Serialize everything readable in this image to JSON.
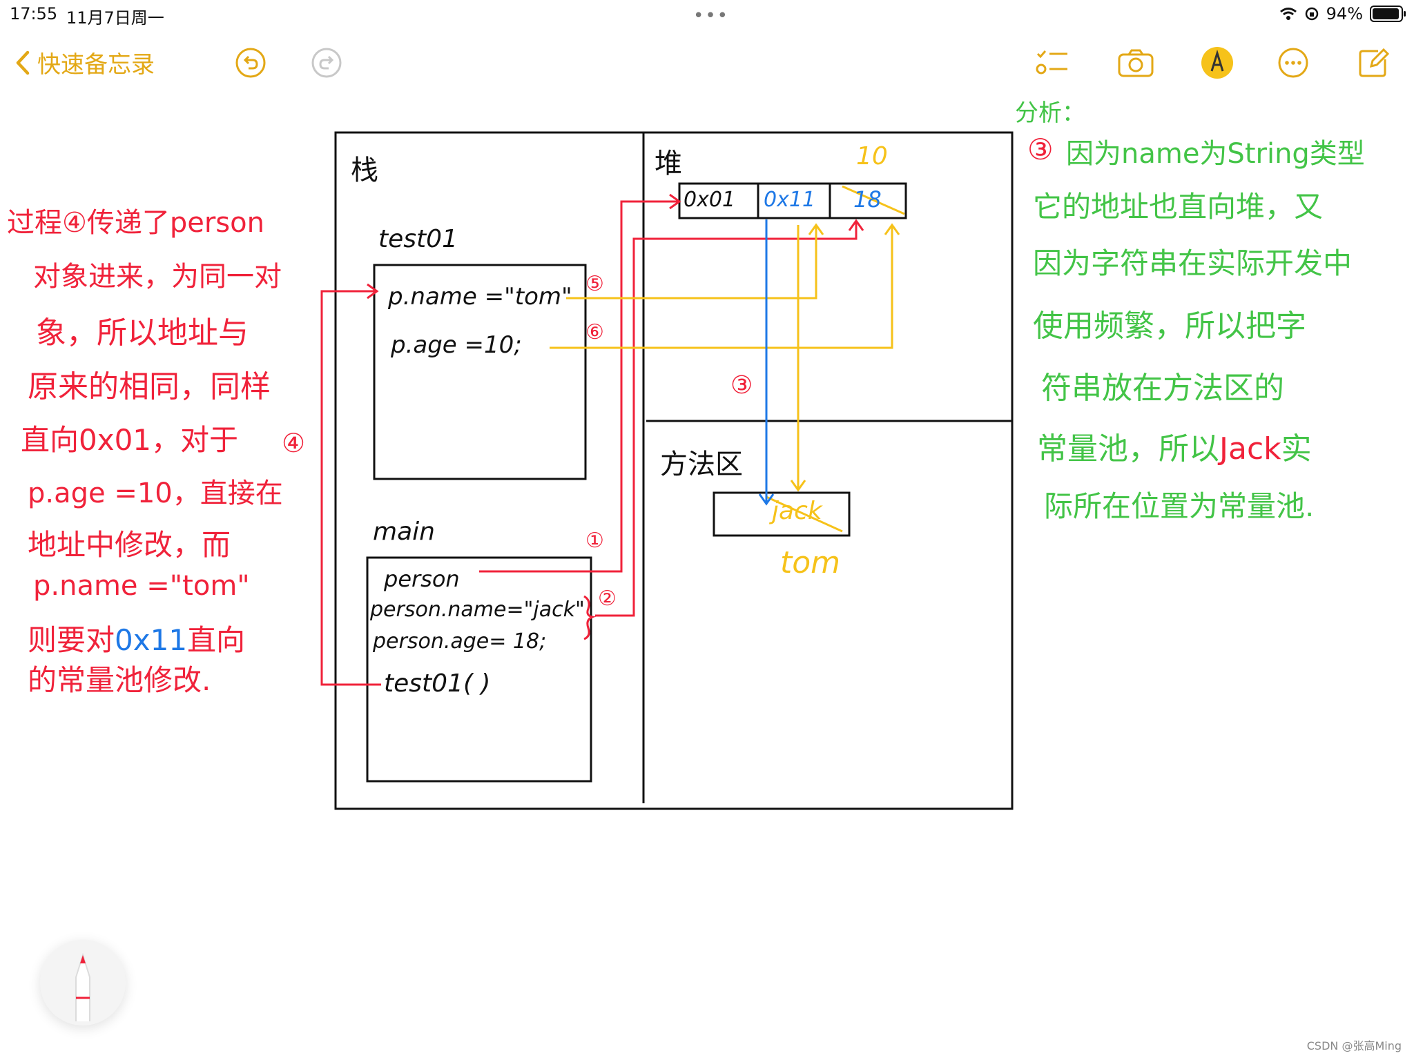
{
  "status_bar": {
    "time": "17:55",
    "date": "11月7日周一",
    "battery": "94%",
    "battery_level": 0.94
  },
  "toolbar": {
    "back_label": "快速备忘录",
    "icons": [
      "undo-icon",
      "redo-icon",
      "checklist-icon",
      "camera-icon",
      "markup-icon",
      "more-icon",
      "compose-icon"
    ]
  },
  "colors": {
    "accent": "#e3a816",
    "red": "#f0223a",
    "green": "#43c447",
    "blue": "#1e78e6",
    "yellow": "#f6c21a"
  },
  "diagram": {
    "stack_label": "栈",
    "heap_label": "堆",
    "method_area_label": "方法区",
    "test01": {
      "title": "test01",
      "line1": "p.name =\"tom\"",
      "line2": "p.age =10;"
    },
    "main": {
      "title": "main",
      "line1": "person",
      "line2": "person.name=\"jack\"",
      "line3": "person.age= 18;",
      "line4": "test01( )"
    },
    "heap_cells": [
      "0x01",
      "0x11",
      "18"
    ],
    "heap_new_value": "10",
    "const_value": "jack",
    "const_new_value": "tom",
    "markers": [
      "①",
      "②",
      "③",
      "④",
      "⑤",
      "⑥"
    ]
  },
  "left_notes": {
    "lines": [
      "过程④传递了person",
      "对象进来，为同一对",
      "象，所以地址与",
      "原来的相同，同样",
      "直向0x01，对于",
      "p.age =10，直接在",
      "地址中修改，而",
      "p.name =\"tom\"",
      "则要对",
      "的常量池修改."
    ],
    "blue_part": "0x11",
    "after_blue": "直向"
  },
  "right_notes": {
    "heading": "分析：",
    "lines": [
      "因为name为String类型",
      "它的地址也直向堆，又",
      "因为字符串在实际开发中",
      "使用频繁，所以把字",
      "符串放在方法区的",
      "常量池，所以",
      "际所在位置为常量池."
    ],
    "jack_word": "Jack",
    "jack_after": "实"
  },
  "watermark": "CSDN @张高Ming"
}
